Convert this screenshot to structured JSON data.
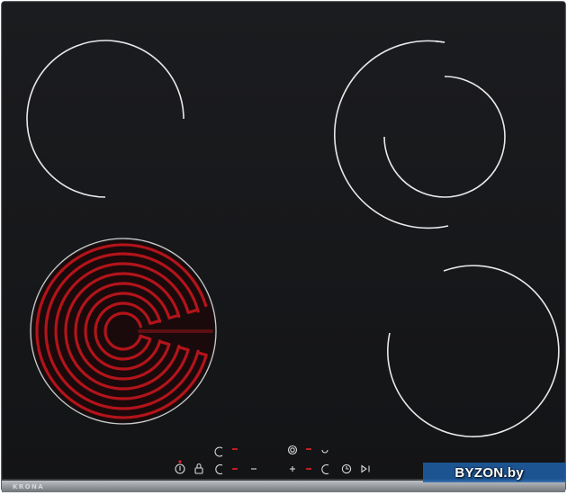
{
  "product": {
    "brand": "KRONA",
    "watermark": "BYZON.by"
  },
  "colors": {
    "glass": "#16171a",
    "zone_outline": "#e9e9ea",
    "heating_coil": "#b2141a",
    "indicator": "#e8202a",
    "frame": "#9aa0a6"
  },
  "cooking_zones": [
    {
      "name": "rear-left",
      "type": "single",
      "active": false
    },
    {
      "name": "rear-right",
      "type": "dual",
      "active": false
    },
    {
      "name": "front-left",
      "type": "single",
      "active": true
    },
    {
      "name": "front-right",
      "type": "single",
      "active": false
    }
  ],
  "controls": [
    {
      "name": "power",
      "icon": "power-icon"
    },
    {
      "name": "lock",
      "icon": "lock-icon"
    },
    {
      "name": "zone-select-front-left",
      "icon": "zone-icon"
    },
    {
      "name": "zone-select-rear-left",
      "icon": "zone-icon"
    },
    {
      "name": "minus",
      "icon": "minus-icon"
    },
    {
      "name": "plus",
      "icon": "plus-icon"
    },
    {
      "name": "zone-select-rear-right",
      "icon": "dual-zone-icon"
    },
    {
      "name": "zone-select-front-right",
      "icon": "zone-icon"
    },
    {
      "name": "timer",
      "icon": "clock-icon"
    },
    {
      "name": "pause",
      "icon": "play-pause-icon"
    }
  ]
}
